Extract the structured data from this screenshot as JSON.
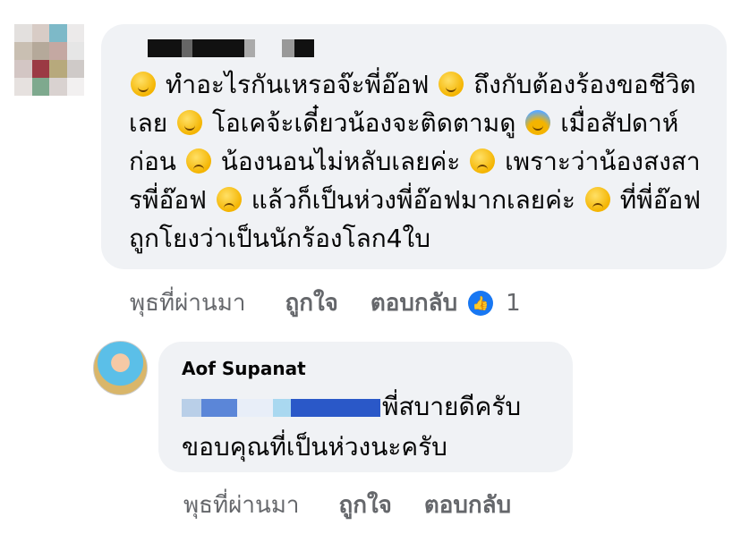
{
  "comment": {
    "author_name_redacted": true,
    "text_parts": [
      {
        "emoji": "smiling-face-icon"
      },
      {
        "text": " ทำอะไรกันเหรอจ๊ะพี่อ๊อฟ "
      },
      {
        "emoji": "halo-face-icon"
      },
      {
        "text": " ถึงกับต้องร้องขอชีวิตเลย "
      },
      {
        "emoji": "kissing-face-icon"
      },
      {
        "text": " โอเคจ้ะเดี๋ยวน้องจะติดตามดู "
      },
      {
        "emoji": "fearful-face-icon"
      },
      {
        "text": " เมื่อสัปดาห์ก่อน "
      },
      {
        "emoji": "crying-face-icon"
      },
      {
        "text": " น้องนอนไม่หลับเลยค่ะ "
      },
      {
        "emoji": "sad-face-icon"
      },
      {
        "text": " เพราะว่าน้องสงสารพี่อ๊อฟ "
      },
      {
        "emoji": "sobbing-face-icon"
      },
      {
        "text": " แล้วก็เป็นห่วงพี่อ๊อฟมากเลยค่ะ "
      },
      {
        "emoji": "weary-face-icon"
      },
      {
        "text": " ที่พี่อ๊อฟถูกโยงว่าเป็นนักร้องโลก4ใบ"
      }
    ],
    "time": "พุธที่ผ่านมา",
    "like_label": "ถูกใจ",
    "reply_label": "ตอบกลับ",
    "reaction_count": "1"
  },
  "reply": {
    "author": "Aof Supanat",
    "line1_suffix": "พี่สบายดีครับ",
    "line2": "ขอบคุณที่เป็นห่วงนะครับ",
    "time": "พุธที่ผ่านมา",
    "like_label": "ถูกใจ",
    "reply_label": "ตอบกลับ"
  },
  "colors": {
    "bubble": "#f0f2f5",
    "meta_text": "#65676b",
    "like_blue": "#1877f2"
  }
}
